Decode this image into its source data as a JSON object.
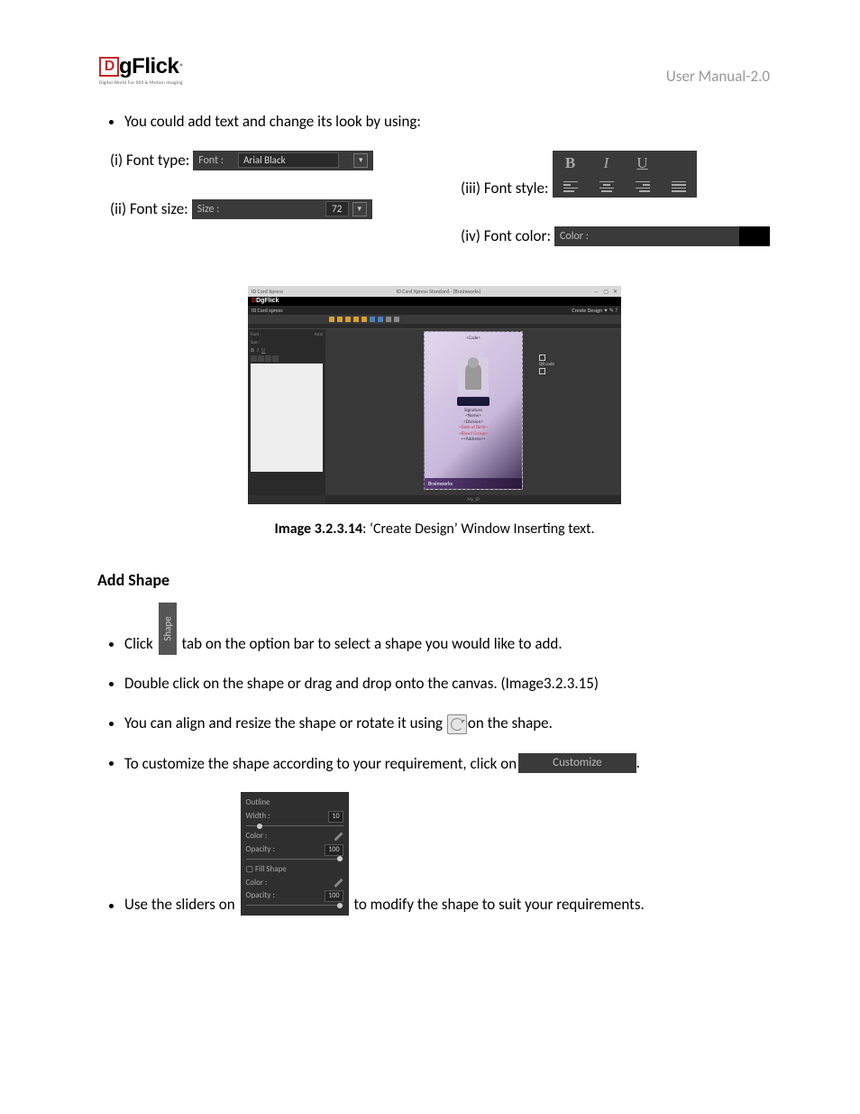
{
  "header": {
    "manual": "User Manual-2.0",
    "logo_tag": "Digital World For Still & Motion Imaging",
    "logo_brand": "gFlick"
  },
  "intro_bullet": "You could add text and change its look by using:",
  "font_type": {
    "label": "(i) Font type:",
    "field_label": "Font :",
    "value": "Arial Black"
  },
  "font_size": {
    "label": "(ii) Font size:",
    "field_label": "Size :",
    "value": "72"
  },
  "font_style": {
    "label": "(iii)  Font style:"
  },
  "font_color": {
    "label": "(iv)  Font color:",
    "field_label": "Color :"
  },
  "appshot": {
    "titlebar_left": "ID Card Xpress",
    "titlebar_mid": "ID Card Xpress Standard - [Brainworks]",
    "brand": "DgFlick",
    "sub": "ID Card xpress",
    "create": "Create Design",
    "side": {
      "font_l": "Font :",
      "font_v": "Arial",
      "size_l": "Size :"
    },
    "card": {
      "code": "<Code>",
      "qr": "QR code",
      "sig": "Signature",
      "name": "<Name>",
      "div": "<Division>",
      "dob": "<Date of Birth>",
      "bg": "<Blood Group>",
      "addr": "+<Address>+",
      "brand": "Brainworks",
      "bottom": "My_ID"
    }
  },
  "caption": {
    "bold": "Image 3.2.3.14",
    "rest": ": ‘Create Design’ Window Inserting text."
  },
  "section": "Add Shape",
  "shape_tab_label": "Shape",
  "bullets": {
    "b1a": "Click ",
    "b1b": " tab on the option bar to select a shape you would like to add.",
    "b2": "Double click on the shape or drag and drop onto the canvas. (Image3.2.3.15)",
    "b3a": "You can align and resize the shape or rotate it using ",
    "b3b": "on the shape.",
    "b4a": "To customize the shape according to your requirement, click on",
    "b4b": ".",
    "b5a": "Use the sliders on ",
    "b5b": " to modify the shape to suit your requirements."
  },
  "customize_label": "Customize",
  "slider_panel": {
    "outline": "Outline",
    "width": "Width :",
    "width_v": "10",
    "color": "Color :",
    "opacity": "Opacity :",
    "op_v": "100",
    "fill": "Fill Shape"
  }
}
